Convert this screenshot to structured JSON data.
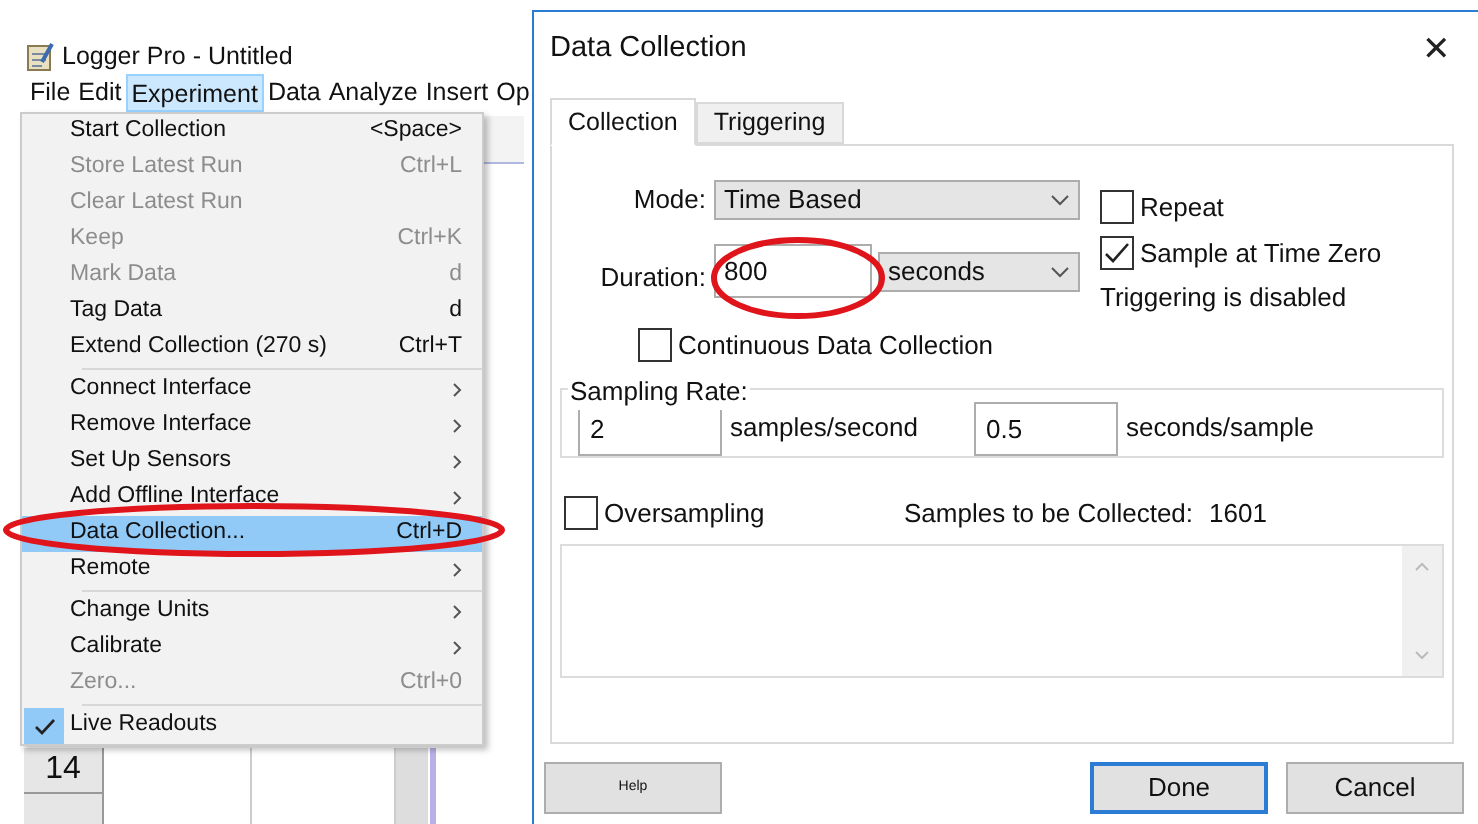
{
  "app": {
    "title": "Logger Pro - Untitled",
    "menubar": [
      {
        "label": "File",
        "selected": false
      },
      {
        "label": "Edit",
        "selected": false
      },
      {
        "label": "Experiment",
        "selected": true
      },
      {
        "label": "Data",
        "selected": false
      },
      {
        "label": "Analyze",
        "selected": false
      },
      {
        "label": "Insert",
        "selected": false
      },
      {
        "label": "Op",
        "selected": false
      }
    ],
    "menu": [
      {
        "kind": "item",
        "label": "Start Collection",
        "shortcut": "<Space>",
        "disabled": false,
        "submenu": false,
        "selected": false,
        "checked": false
      },
      {
        "kind": "item",
        "label": "Store Latest Run",
        "shortcut": "Ctrl+L",
        "disabled": true,
        "submenu": false,
        "selected": false,
        "checked": false
      },
      {
        "kind": "item",
        "label": "Clear Latest Run",
        "disabled": true,
        "submenu": false,
        "selected": false,
        "checked": false
      },
      {
        "kind": "item",
        "label": "Keep",
        "shortcut": "Ctrl+K",
        "disabled": true,
        "submenu": false,
        "selected": false,
        "checked": false
      },
      {
        "kind": "item",
        "label": "Mark Data",
        "shortcut": "d",
        "disabled": true,
        "submenu": false,
        "selected": false,
        "checked": false
      },
      {
        "kind": "item",
        "label": "Tag Data",
        "shortcut": "d",
        "disabled": false,
        "submenu": false,
        "selected": false,
        "checked": false
      },
      {
        "kind": "item",
        "label": "Extend Collection (270 s)",
        "shortcut": "Ctrl+T",
        "disabled": false,
        "submenu": false,
        "selected": false,
        "checked": false
      },
      {
        "kind": "separator"
      },
      {
        "kind": "item",
        "label": "Connect Interface",
        "disabled": false,
        "submenu": true,
        "selected": false,
        "checked": false
      },
      {
        "kind": "item",
        "label": "Remove Interface",
        "disabled": false,
        "submenu": true,
        "selected": false,
        "checked": false
      },
      {
        "kind": "item",
        "label": "Set Up Sensors",
        "disabled": false,
        "submenu": true,
        "selected": false,
        "checked": false
      },
      {
        "kind": "item",
        "label": "Add Offline Interface",
        "disabled": false,
        "submenu": true,
        "selected": false,
        "checked": false
      },
      {
        "kind": "item",
        "label": "Data Collection...",
        "shortcut": "Ctrl+D",
        "disabled": false,
        "submenu": false,
        "selected": true,
        "checked": false
      },
      {
        "kind": "item",
        "label": "Remote",
        "disabled": false,
        "submenu": true,
        "selected": false,
        "checked": false
      },
      {
        "kind": "separator"
      },
      {
        "kind": "item",
        "label": "Change Units",
        "disabled": false,
        "submenu": true,
        "selected": false,
        "checked": false
      },
      {
        "kind": "item",
        "label": "Calibrate",
        "disabled": false,
        "submenu": true,
        "selected": false,
        "checked": false
      },
      {
        "kind": "item",
        "label": "Zero...",
        "shortcut": "Ctrl+0",
        "disabled": true,
        "submenu": false,
        "selected": false,
        "checked": false
      },
      {
        "kind": "separator"
      },
      {
        "kind": "item",
        "label": "Live Readouts",
        "disabled": false,
        "submenu": false,
        "selected": false,
        "checked": true
      }
    ],
    "table_row_number": "14"
  },
  "dialog": {
    "title": "Data Collection",
    "close": "✕",
    "tabs": [
      {
        "label": "Collection",
        "selected": true
      },
      {
        "label": "Triggering",
        "selected": false
      }
    ],
    "mode": {
      "label": "Mode:",
      "value": "Time Based"
    },
    "duration": {
      "label": "Duration:",
      "value": "800",
      "unit": "seconds"
    },
    "repeat": {
      "label": "Repeat",
      "checked": false
    },
    "sample_at_time_zero": {
      "label": "Sample at Time Zero",
      "checked": true
    },
    "triggering_status": "Triggering is disabled",
    "continuous": {
      "label": "Continuous Data Collection",
      "checked": false
    },
    "sampling_rate": {
      "label": "Sampling Rate:",
      "rate": "2",
      "rate_unit": "samples/second",
      "period": "0.5",
      "period_unit": "seconds/sample"
    },
    "oversampling": {
      "label": "Oversampling",
      "checked": false
    },
    "samples_label": "Samples to be Collected:",
    "samples_value": "1601",
    "buttons": [
      {
        "kind": "help",
        "label": "Help"
      },
      {
        "kind": "default",
        "label": "Done"
      },
      {
        "kind": "normal",
        "label": "Cancel"
      }
    ]
  }
}
